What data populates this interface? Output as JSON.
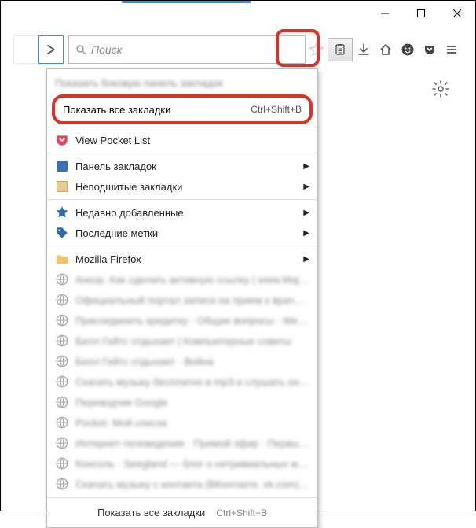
{
  "window": {},
  "toolbar": {
    "search_placeholder": "Поиск"
  },
  "menu": {
    "show_sidebar": "Показать боковую панель закладок",
    "highlighted": {
      "label": "Показать все закладки",
      "shortcut": "Ctrl+Shift+B"
    },
    "pocket": "View Pocket List",
    "bookmarks_panel": "Панель закладок",
    "unsorted_bookmarks": "Неподшитые закладки",
    "recently_added": "Недавно добавленные",
    "recent_tags": "Последние метки",
    "folder_firefox": "Mozilla Firefox",
    "blurred_items": [
      "Анкор. Как сделать активную ссылку | www.Maj…",
      "Официальный портал записи на прием к врачу …",
      "Присоединить кредитку · Общие вопросы · We…",
      "Билл Гейтс отдыхает | Компьютерные советы",
      "Билл Гейтс отдыхает · Война",
      "Скачать музыку бесплатно в mp3 и слушать онл…",
      "Переводчик Google",
      "Pocket: Мой список",
      "Интернет-телевидение · Прямой эфир · Первый…",
      "Консоль · Seegland — блог о нетривиальных мест…",
      "Скачать музыку с контакта (ВКонтакте, vk.com) …"
    ],
    "footer": {
      "label": "Показать все закладки",
      "shortcut": "Ctrl+Shift+B"
    }
  }
}
